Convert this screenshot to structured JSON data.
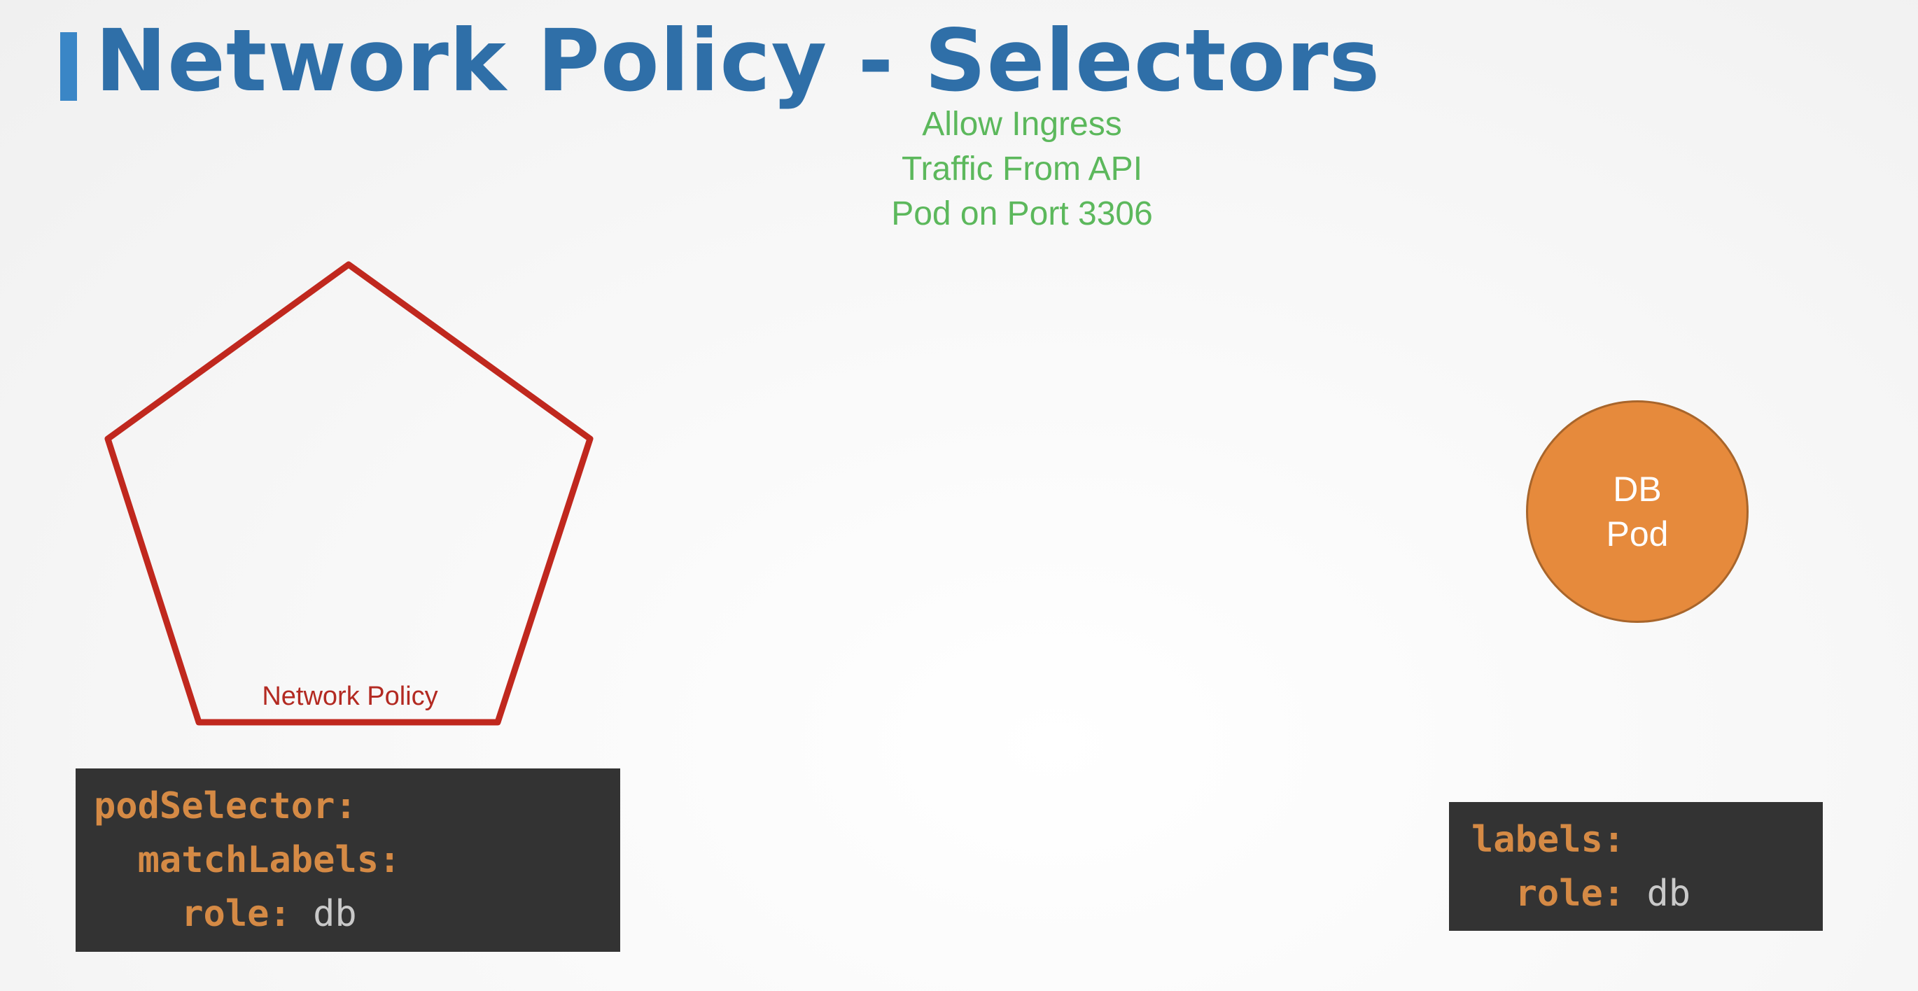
{
  "title": "Network Policy - Selectors",
  "subtitle": {
    "line1": "Allow Ingress",
    "line2": "Traffic From API",
    "line3": "Pod on Port 3306"
  },
  "network_policy": {
    "label": "Network Policy",
    "color": "#c0281e"
  },
  "db_pod": {
    "line1": "DB",
    "line2": "Pod",
    "color": "#e68a3c"
  },
  "policy_yaml": {
    "key1": "podSelector:",
    "key2": "matchLabels:",
    "key3": "role:",
    "value3": "db"
  },
  "pod_yaml": {
    "key1": "labels:",
    "key2": "role:",
    "value2": "db"
  },
  "colors": {
    "title": "#2f6fa8",
    "title_accent": "#3a86c6",
    "subtitle": "#5cb85c",
    "code_bg": "#333333",
    "code_key": "#d58a45",
    "code_value": "#c9c9c9"
  }
}
